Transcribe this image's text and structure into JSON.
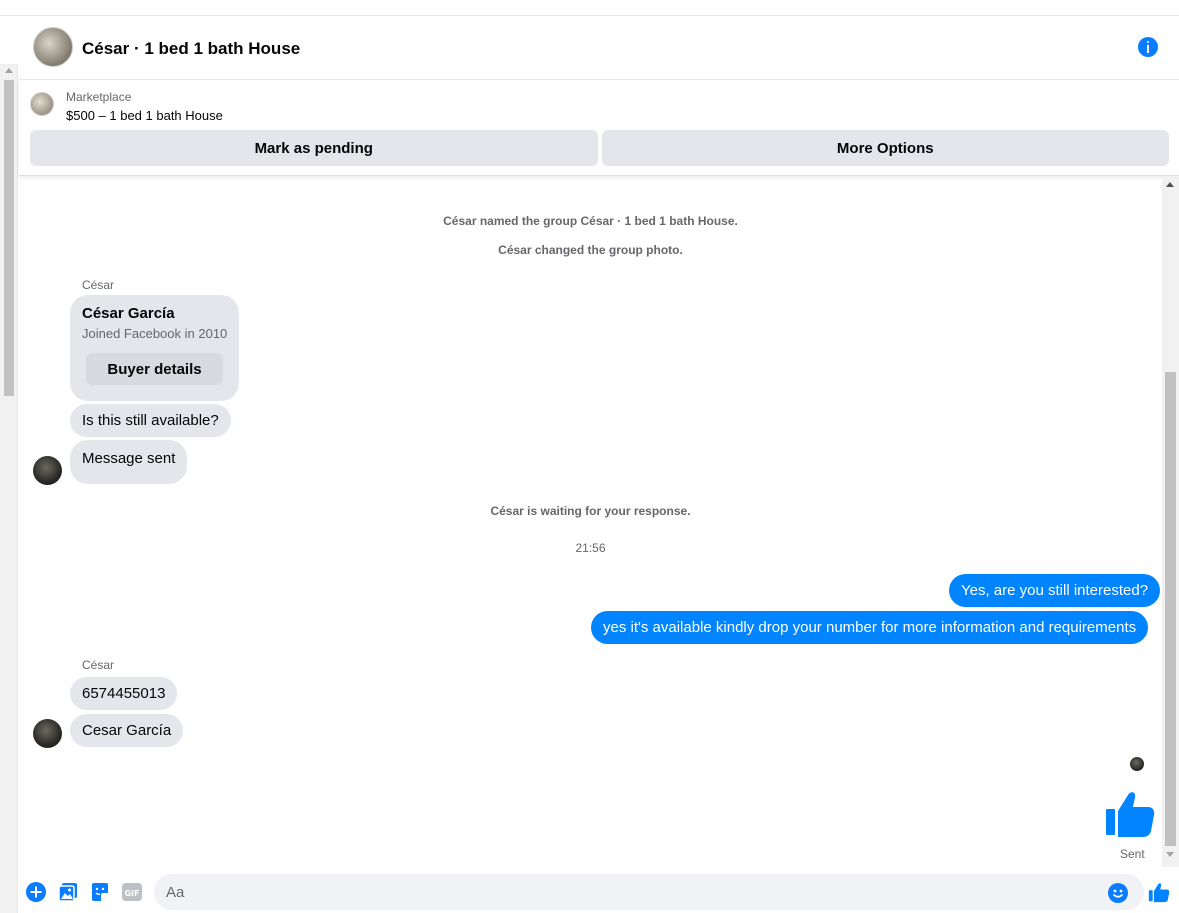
{
  "header": {
    "title": "César · 1 bed 1 bath House"
  },
  "listing": {
    "label": "Marketplace",
    "price_title": "$500 – 1 bed 1 bath House",
    "mark_pending": "Mark as pending",
    "more_options": "More Options"
  },
  "thread": {
    "sys1": "César named the group César · 1 bed 1 bath House.",
    "sys2": "César changed the group photo.",
    "sender1": "César",
    "card": {
      "name": "César García",
      "joined": "Joined Facebook in 2010",
      "button": "Buyer details"
    },
    "msg1": "Is this still available?",
    "msg2": "Message sent",
    "sys3": "César is waiting for your response.",
    "timestamp": "21:56",
    "out1": "Yes, are you still interested?",
    "out2": "yes it's available kindly drop your number for more information and requirements",
    "sender2": "César",
    "msg3": "6574455013",
    "msg4": "Cesar García",
    "sent": "Sent"
  },
  "composer": {
    "placeholder": "Aa",
    "gif_label": "GIF"
  },
  "colors": {
    "accent": "#0084ff",
    "icon_blue": "#0a7cff",
    "bubble_gray": "#e4e6eb"
  }
}
